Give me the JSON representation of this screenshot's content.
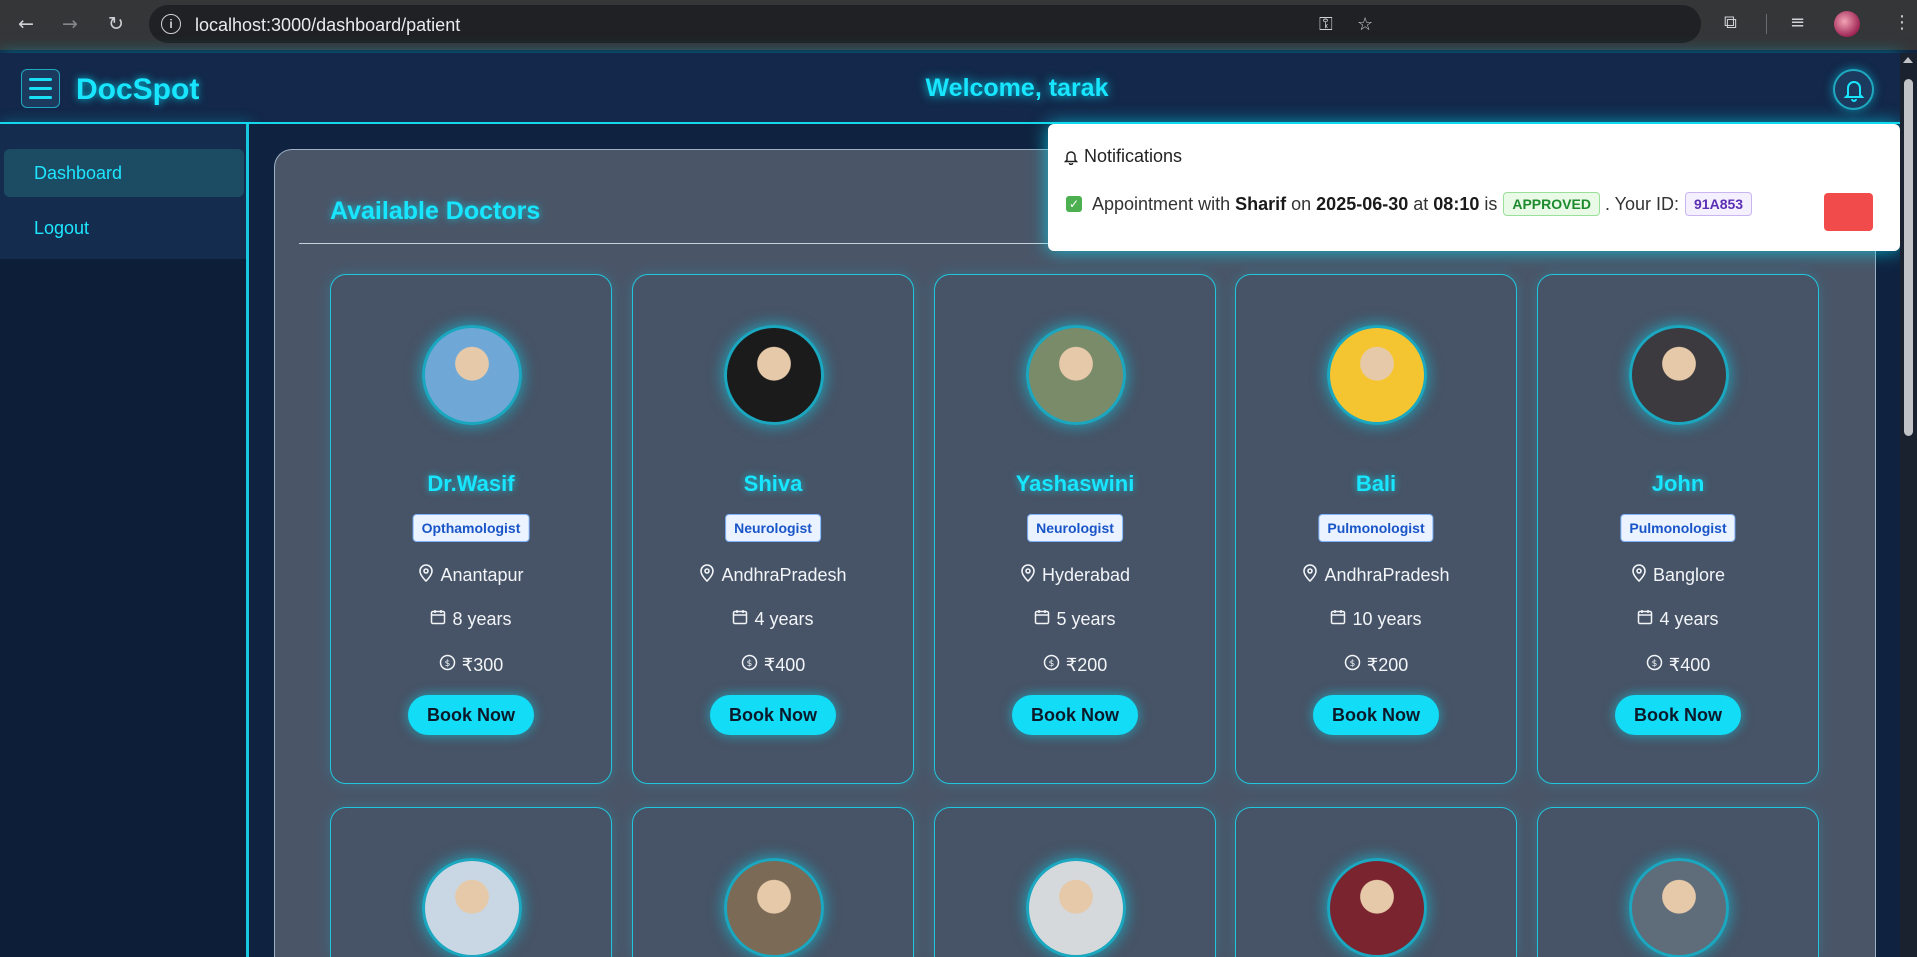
{
  "browser": {
    "url": "localhost:3000/dashboard/patient"
  },
  "header": {
    "brand": "DocSpot",
    "welcome": "Welcome, tarak"
  },
  "sidebar": {
    "items": [
      {
        "label": "Dashboard",
        "active": true
      },
      {
        "label": "Logout",
        "active": false
      }
    ]
  },
  "main": {
    "title": "Available Doctors"
  },
  "doctors": [
    {
      "name": "Dr.Wasif",
      "specialization": "Opthamologist",
      "location": "Anantapur",
      "experience": "8 years",
      "fee": "₹300",
      "book_label": "Book Now",
      "avatar_color": "#6fa8d6"
    },
    {
      "name": "Shiva",
      "specialization": "Neurologist",
      "location": "AndhraPradesh",
      "experience": "4 years",
      "fee": "₹400",
      "book_label": "Book Now",
      "avatar_color": "#1b1b1b"
    },
    {
      "name": "Yashaswini",
      "specialization": "Neurologist",
      "location": "Hyderabad",
      "experience": "5 years",
      "fee": "₹200",
      "book_label": "Book Now",
      "avatar_color": "#7a8b6a"
    },
    {
      "name": "Bali",
      "specialization": "Pulmonologist",
      "location": "AndhraPradesh",
      "experience": "10 years",
      "fee": "₹200",
      "book_label": "Book Now",
      "avatar_color": "#f5c531"
    },
    {
      "name": "John",
      "specialization": "Pulmonologist",
      "location": "Banglore",
      "experience": "4 years",
      "fee": "₹400",
      "book_label": "Book Now",
      "avatar_color": "#3c3a3f"
    }
  ],
  "doctors_row2": [
    {
      "avatar_color": "#c9d6e3"
    },
    {
      "avatar_color": "#7b6a55"
    },
    {
      "avatar_color": "#d6d9dc"
    },
    {
      "avatar_color": "#7a2430"
    },
    {
      "avatar_color": "#5f6c7a"
    }
  ],
  "notifications": {
    "title": "Notifications",
    "items": [
      {
        "prefix": "Appointment with",
        "doctor": "Sharif",
        "on": "on",
        "date": "2025-06-30",
        "at": "at",
        "time": "08:10",
        "is": "is",
        "status": "APPROVED",
        "id_label": ". Your ID:",
        "id": "91A853"
      }
    ]
  },
  "colors": {
    "accent": "#18e6ff",
    "bg": "#0f2340",
    "panel": "#4a5568",
    "delete": "#f24b4b"
  }
}
